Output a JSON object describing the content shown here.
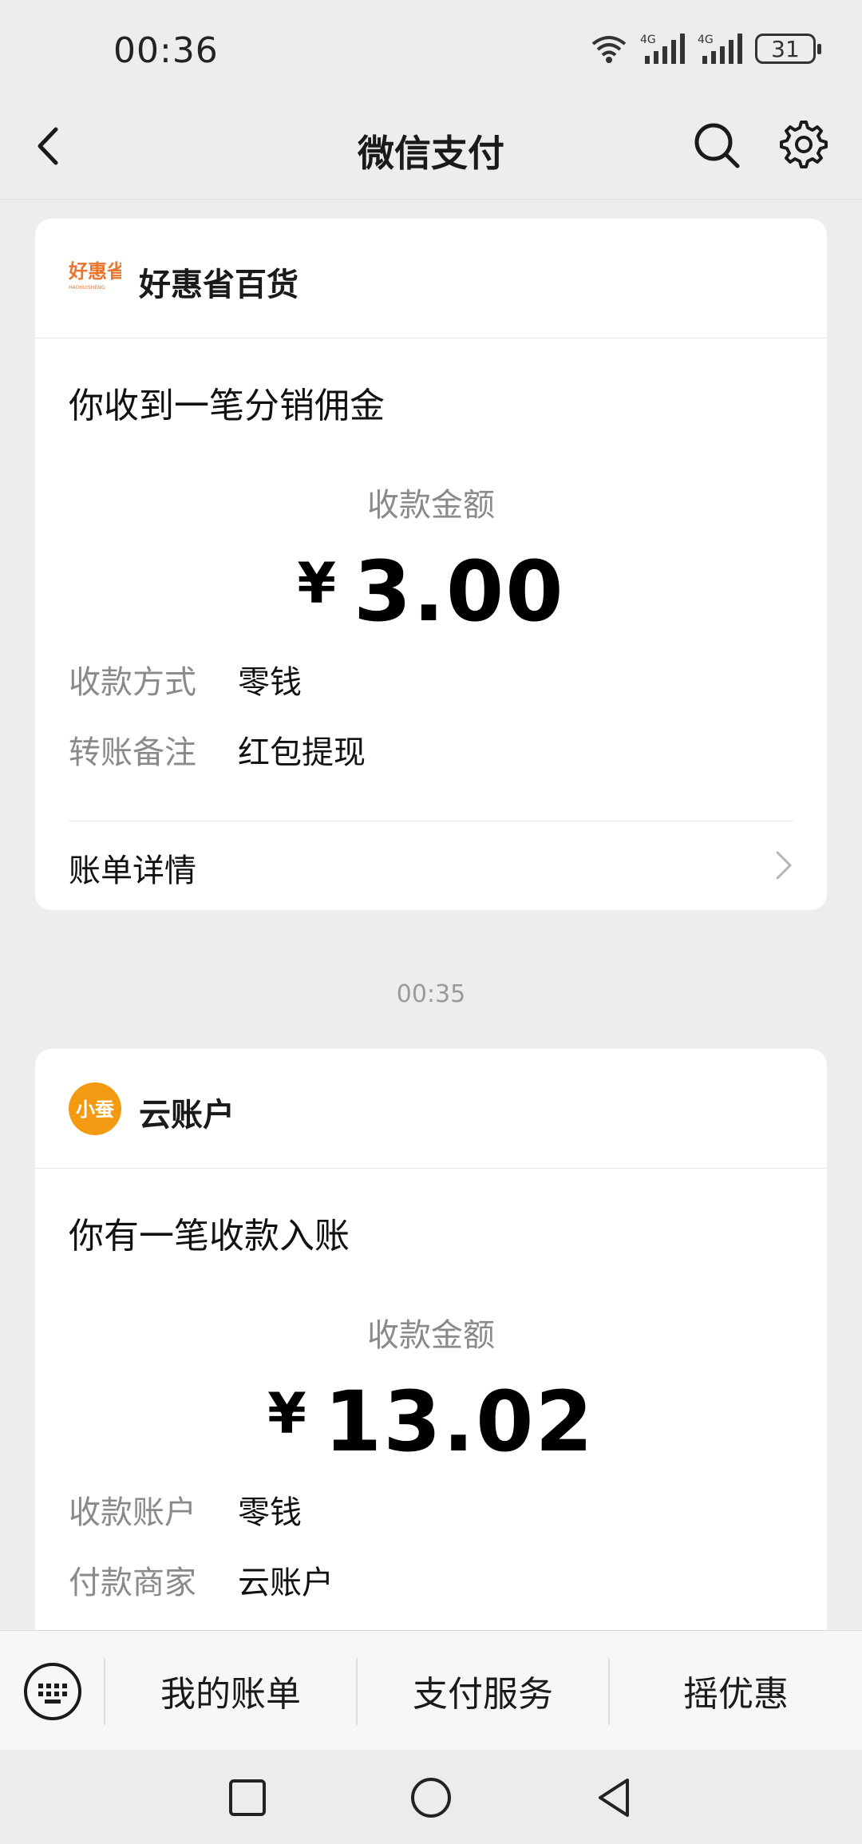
{
  "status_bar": {
    "time": "00:36",
    "battery": "31",
    "signal_labels": [
      "4G",
      "4G"
    ]
  },
  "nav": {
    "title": "微信支付"
  },
  "card1": {
    "merchant": "好惠省百货",
    "logo_text": "好惠省",
    "logo_subtext": "HAOHUISHENG",
    "title": "你收到一笔分销佣金",
    "amount_label": "收款金额",
    "currency": "¥",
    "amount": "3.00",
    "rows": [
      {
        "label": "收款方式",
        "value": "零钱"
      },
      {
        "label": "转账备注",
        "value": "红包提现"
      }
    ],
    "bill_link": "账单详情"
  },
  "timestamp": "00:35",
  "card2": {
    "merchant": "云账户",
    "logo_text": "小蚕",
    "title": "你有一笔收款入账",
    "amount_label": "收款金额",
    "currency": "¥",
    "amount": "13.02",
    "rows": [
      {
        "label": "收款账户",
        "value": "零钱"
      },
      {
        "label": "付款商家",
        "value": "云账户"
      }
    ]
  },
  "bottom_menu": {
    "items": [
      "我的账单",
      "支付服务",
      "摇优惠"
    ]
  },
  "colors": {
    "background": "#ededed",
    "card": "#ffffff",
    "brand_orange": "#e8762d",
    "logo2_orange": "#f39a12"
  },
  "icons": [
    "wifi-icon",
    "signal-icon",
    "battery-icon",
    "back-icon",
    "search-icon",
    "gear-icon",
    "chevron-right-icon",
    "keyboard-icon",
    "square-icon",
    "circle-icon",
    "triangle-back-icon"
  ]
}
